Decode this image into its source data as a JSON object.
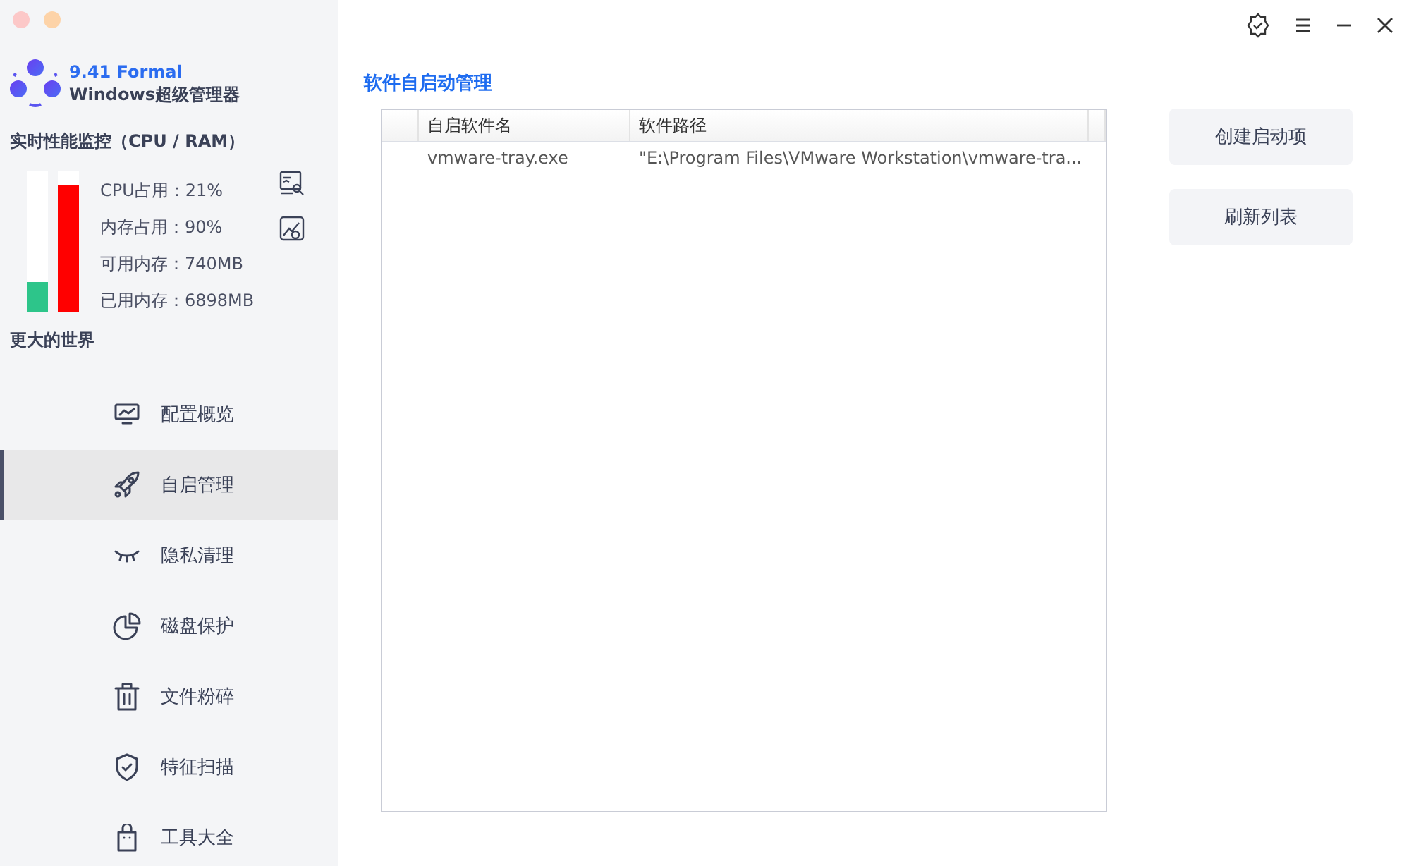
{
  "window": {
    "traffic_lights": [
      {
        "color": "#fcc8c8"
      },
      {
        "color": "#fdd3a8"
      }
    ]
  },
  "app": {
    "version": "9.41 Formal",
    "name": "Windows超级管理器"
  },
  "monitor": {
    "title": "实时性能监控（CPU / RAM）",
    "meters": [
      {
        "level": 0.21,
        "color": "#2dc58a"
      },
      {
        "level": 0.9,
        "color": "#ff0000"
      }
    ],
    "stats": [
      "CPU占用：21%",
      "内存占用：90%",
      "可用内存：740MB",
      "已用内存：6898MB"
    ],
    "footer": "更大的世界"
  },
  "nav": [
    {
      "label": "配置概览",
      "selected": false
    },
    {
      "label": "自启管理",
      "selected": true
    },
    {
      "label": "隐私清理",
      "selected": false
    },
    {
      "label": "磁盘保护",
      "selected": false
    },
    {
      "label": "文件粉碎",
      "selected": false
    },
    {
      "label": "特征扫描",
      "selected": false
    },
    {
      "label": "工具大全",
      "selected": false
    }
  ],
  "heading": "软件自启动管理",
  "table": {
    "columns": [
      "自启软件名",
      "软件路径"
    ],
    "rows": [
      [
        "vmware-tray.exe",
        "\"E:\\Program Files\\VMware Workstation\\vmware-tra..."
      ]
    ]
  },
  "buttons": [
    "创建启动项",
    "刷新列表"
  ]
}
